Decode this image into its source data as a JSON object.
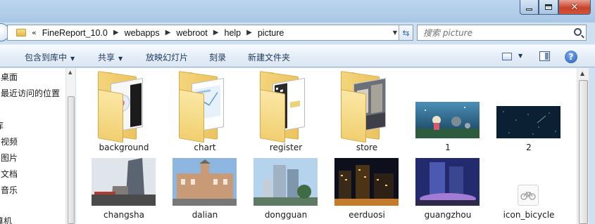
{
  "address": {
    "overflow": "«",
    "crumbs": [
      "FineReport_10.0",
      "webapps",
      "webroot",
      "help",
      "picture"
    ]
  },
  "search": {
    "placeholder": "搜索 picture"
  },
  "toolbar": {
    "include_library": "包含到库中",
    "share": "共享",
    "slideshow": "放映幻灯片",
    "burn": "刻录",
    "new_folder": "新建文件夹"
  },
  "nav": {
    "items": [
      "桌面",
      "最近访问的位置",
      "库",
      "视频",
      "图片",
      "文档",
      "音乐",
      "算机"
    ]
  },
  "files": {
    "row1": [
      "background",
      "chart",
      "register",
      "store",
      "1",
      "2"
    ],
    "row2": [
      "changsha",
      "dalian",
      "dongguan",
      "eerduosi",
      "guangzhou",
      "icon_bicycle"
    ]
  },
  "colors": {
    "accent": "#1e395b",
    "window": "#cfe0f1",
    "close": "#c7442b"
  }
}
